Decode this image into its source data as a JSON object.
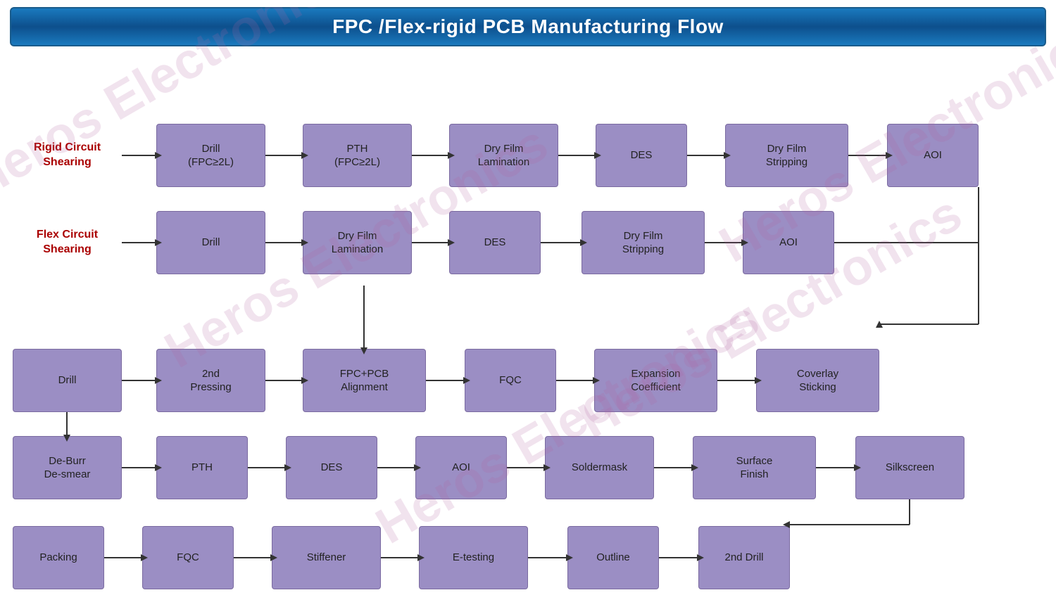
{
  "header": {
    "title": "FPC /Flex-rigid PCB Manufacturing Flow"
  },
  "watermark": "Heros Electronics",
  "boxes": {
    "rigid_circuit_shearing": "Rigid Circuit\nShearing",
    "drill_fpc_2l_row1": "Drill\n(FPC≥2L)",
    "pth_fpc_2l": "PTH\n(FPC≥2L)",
    "dry_film_lamination_1": "Dry Film\nLamination",
    "des_1": "DES",
    "dry_film_stripping_1": "Dry Film\nStripping",
    "aoi_1": "AOI",
    "flex_circuit_shearing": "Flex Circuit\nShearing",
    "drill_row2": "Drill",
    "dry_film_lamination_2": "Dry Film\nLamination",
    "des_2": "DES",
    "dry_film_stripping_2": "Dry Film\nStripping",
    "aoi_2": "AOI",
    "drill_row3": "Drill",
    "second_pressing": "2nd\nPressing",
    "fpc_pcb_alignment": "FPC+PCB\nAlignment",
    "fqc_1": "FQC",
    "expansion_coefficient": "Expansion\nCoefficient",
    "coverlay_sticking": "Coverlay\nSticking",
    "de_burr_de_smear": "De-Burr\nDe-smear",
    "pth_row4": "PTH",
    "des_3": "DES",
    "aoi_3": "AOI",
    "soldermask": "Soldermask",
    "surface_finish": "Surface\nFinish",
    "silkscreen": "Silkscreen",
    "packing": "Packing",
    "fqc_2": "FQC",
    "stiffener": "Stiffener",
    "e_testing": "E-testing",
    "outline": "Outline",
    "second_drill": "2nd Drill"
  }
}
